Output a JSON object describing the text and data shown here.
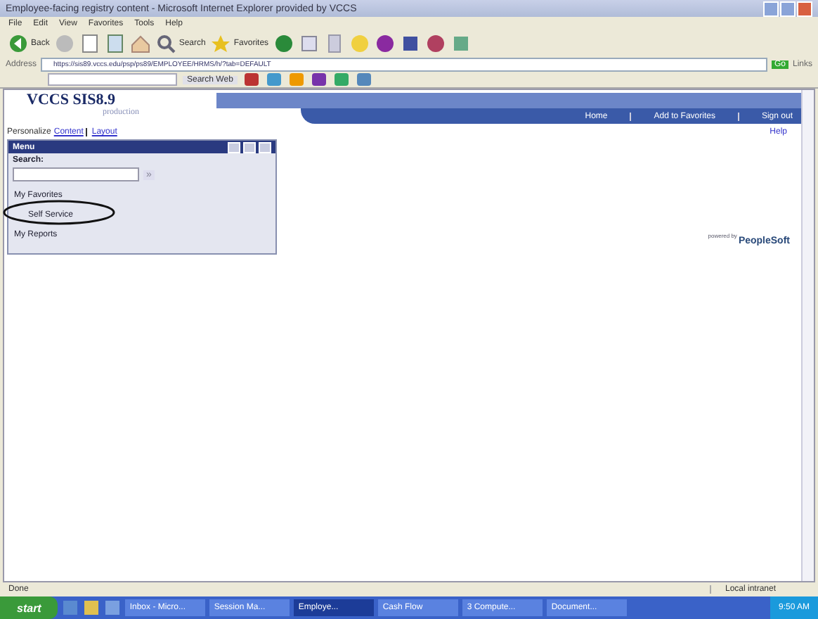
{
  "window": {
    "title": "Employee-facing registry content - Microsoft Internet Explorer provided by VCCS"
  },
  "menu_bar": [
    "File",
    "Edit",
    "View",
    "Favorites",
    "Tools",
    "Help"
  ],
  "toolbar": [
    {
      "label": "Back"
    },
    {
      "label": "Search"
    },
    {
      "label": "Favorites"
    }
  ],
  "address_bar": {
    "label": "Address",
    "value": "https://sis89.vccs.edu/psp/ps89/EMPLOYEE/HRMS/h/?tab=DEFAULT",
    "go": "Go",
    "links": "Links"
  },
  "search_toolbar": {
    "button": "Search Web"
  },
  "page": {
    "brand": "VCCS SIS8.9",
    "environment": "production",
    "nav_links": [
      {
        "label": "Home"
      },
      {
        "label": "Add to Favorites"
      },
      {
        "label": "Sign out"
      }
    ],
    "help": "Help",
    "personalize": {
      "label": "Personalize",
      "links": [
        "Content",
        "Layout"
      ]
    },
    "menu": {
      "title": "Menu",
      "search_label": "Search:",
      "search_button": "»",
      "items": [
        {
          "label": "My Favorites",
          "circled": false
        },
        {
          "label": "Self Service",
          "circled": true
        },
        {
          "label": "My Reports",
          "circled": false
        }
      ]
    },
    "logo": {
      "prefix": "powered by",
      "name": "PeopleSoft"
    }
  },
  "status_bar": {
    "text": "Done",
    "zone": "Local intranet"
  },
  "taskbar": {
    "start": "start",
    "windows": [
      {
        "label": "Inbox - Micro...",
        "selected": false
      },
      {
        "label": "Session Ma...",
        "selected": false
      },
      {
        "label": "Employe...",
        "selected": true
      },
      {
        "label": "Cash Flow",
        "selected": false
      },
      {
        "label": "3 Compute...",
        "selected": false
      },
      {
        "label": "Document...",
        "selected": false
      }
    ],
    "clock": "9:50 AM"
  }
}
